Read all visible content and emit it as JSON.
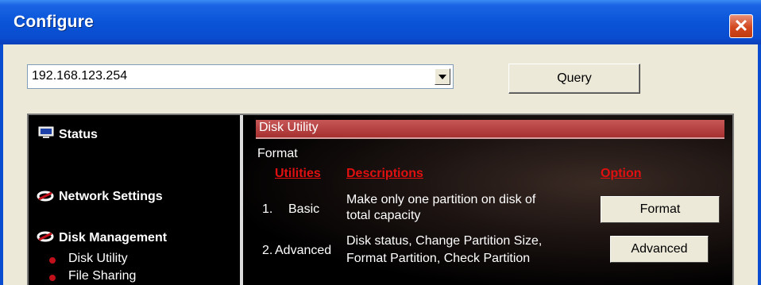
{
  "window": {
    "title": "Configure",
    "close_label": "✕"
  },
  "toolbar": {
    "address_value": "192.168.123.254",
    "query_label": "Query"
  },
  "sidebar": {
    "status_label": "Status",
    "network_label": "Network Settings",
    "disk_label": "Disk Management",
    "sub_items": [
      "Disk Utility",
      "File Sharing"
    ]
  },
  "content": {
    "header": "Disk Utility",
    "section": "Format",
    "columns": {
      "utilities": "Utilities",
      "descriptions": "Descriptions",
      "option": "Option"
    },
    "rows": [
      {
        "num": "1.",
        "name": "Basic",
        "desc_line1": "Make only one partition on disk of",
        "desc_line2": "total capacity",
        "button": "Format"
      },
      {
        "num": "2.",
        "name": "Advanced",
        "desc_line1": "Disk status, Change Partition Size,",
        "desc_line2": "Format Partition, Check Partition",
        "button": "Advanced"
      }
    ]
  },
  "colors": {
    "title_blue": "#0a54d8",
    "header_red": "#a63030",
    "column_red": "#e01010",
    "bullet_red": "#c0101a"
  }
}
